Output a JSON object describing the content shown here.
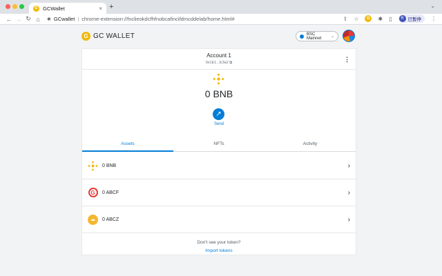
{
  "browser": {
    "tab_title": "GCWallet",
    "tab_close": "×",
    "new_tab": "+",
    "site_name": "GCwallet",
    "separator": "|",
    "url": "chrome-extension://fnclieokdcfhfnobcafincifdmcddelab/home.html#",
    "profile_initial": "R",
    "profile_label": "已暫停"
  },
  "header": {
    "logo_mark": "G",
    "app_name": "GC WALLET",
    "network": "BSC Mainnet",
    "network_color": "#037dd6"
  },
  "account": {
    "name": "Account 1",
    "address": "0x1E1...E3a2 ⧉",
    "menu_icon": "⋮"
  },
  "balance": {
    "amount": "0 BNB",
    "send_label": "Send"
  },
  "tabs": [
    {
      "label": "Assets",
      "active": true
    },
    {
      "label": "NFTs",
      "active": false
    },
    {
      "label": "Activity",
      "active": false
    }
  ],
  "assets": [
    {
      "label": "0 BNB",
      "icon": "bnb-icon"
    },
    {
      "label": "0 ABCF",
      "icon": "g-token-icon"
    },
    {
      "label": "0 ABCZ",
      "icon": "z-token-icon"
    }
  ],
  "footer": {
    "question": "Don't see your token?",
    "link": "Import tokens"
  },
  "colors": {
    "accent": "#037dd6",
    "bnb": "#f0b90b",
    "background": "#f2f3f4"
  }
}
